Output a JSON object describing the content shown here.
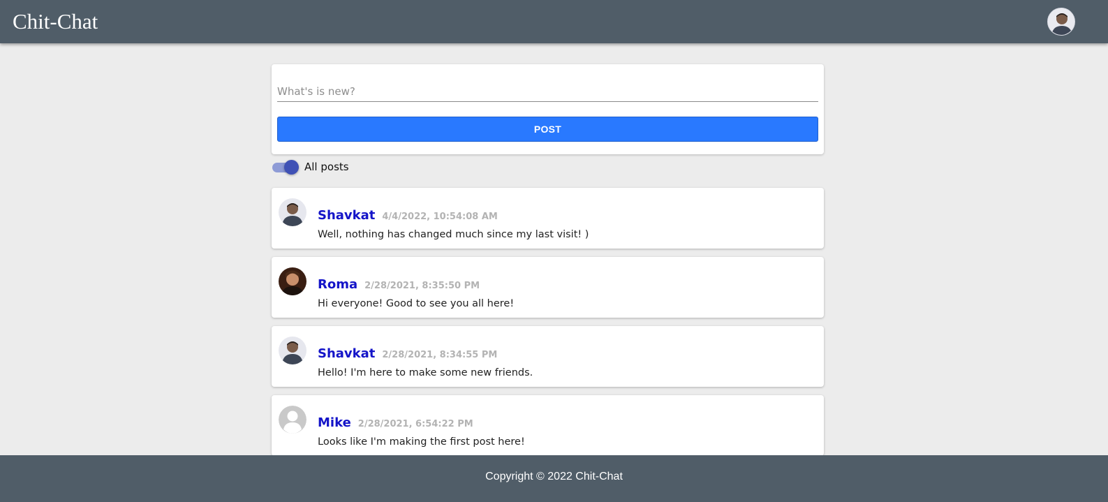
{
  "header": {
    "brand": "Chit-Chat",
    "user_avatar": "user-avatar-photo"
  },
  "composer": {
    "placeholder": "What's is new?",
    "value": "",
    "post_label": "POST",
    "accent": "#2979ff"
  },
  "filter": {
    "toggle_on": true,
    "label": "All posts"
  },
  "posts": [
    {
      "author": "Shavkat",
      "date": "4/4/2022, 10:54:08 AM",
      "text": "Well, nothing has changed much since my last visit! )",
      "avatar": "photo-man-light-background"
    },
    {
      "author": "Roma",
      "date": "2/28/2021, 8:35:50 PM",
      "text": "Hi everyone! Good to see you all here!",
      "avatar": "photo-man-dark-background"
    },
    {
      "author": "Shavkat",
      "date": "2/28/2021, 8:34:55 PM",
      "text": "Hello! I'm here to make some new friends.",
      "avatar": "photo-man-light-background"
    },
    {
      "author": "Mike",
      "date": "2/28/2021, 6:54:22 PM",
      "text": "Looks like I'm making the first post here!",
      "avatar": "default-user-icon"
    }
  ],
  "footer": {
    "copyright": "Copyright © 2022 Chit-Chat"
  },
  "colors": {
    "header_bg": "#505d68",
    "page_bg": "#ececec",
    "author": "#1414c8",
    "date": "#b3b3b3",
    "toggle_track": "#8e9bd6",
    "toggle_thumb": "#3f51b5"
  }
}
